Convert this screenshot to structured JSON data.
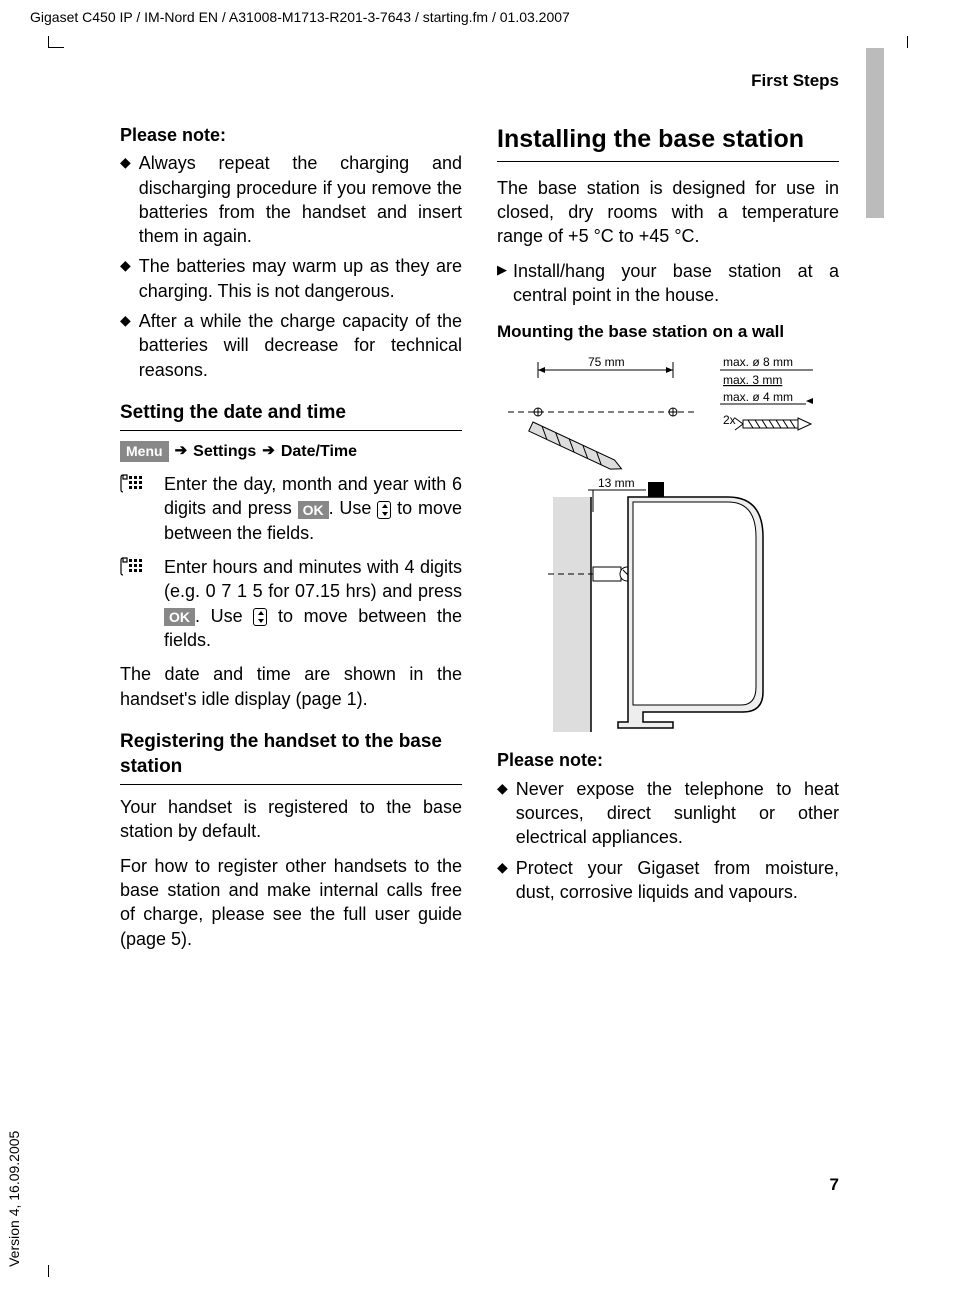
{
  "header": "Gigaset C450 IP / IM-Nord EN / A31008-M1713-R201-3-7643 / starting.fm / 01.03.2007",
  "section_header": "First Steps",
  "left": {
    "note_heading": "Please note:",
    "notes": [
      "Always repeat the charging and discharging procedure if you remove the batteries from the handset and insert them in again.",
      "The batteries may warm up as they are charging. This is not dangerous.",
      "After a while the charge capacity of the batteries will decrease for technical reasons."
    ],
    "h2_datetime": "Setting the date and time",
    "menu_path": {
      "menu": "Menu",
      "settings": "Settings",
      "datetime": "Date/Time"
    },
    "instr1": "Enter the day, month and year with 6 digits and press ",
    "instr1_ok": "OK",
    "instr1_rest": ". Use ",
    "instr1_rest2": " to move between the fields.",
    "instr2": "Enter hours and minutes with 4 digits (e.g. 0 7 1 5 for 07.15 hrs) and press ",
    "instr2_ok": "OK",
    "instr2_rest": ". Use ",
    "instr2_rest2": " to move between the fields.",
    "datetime_footer": "The date and time are shown in the handset's idle display (page 1).",
    "h2_register": "Registering the handset to the base station",
    "register_p1": "Your handset is registered to the base station by default.",
    "register_p2": "For how to register other handsets to the base station and make internal calls free of charge, please see the full user guide (page 5)."
  },
  "right": {
    "h1": "Installing the base station",
    "intro": "The base station is designed for use in closed, dry rooms with a temperature range of +5 °C to +45 °C.",
    "step1": "Install/hang your base station at a central point in the house.",
    "h3_mounting": "Mounting the base station on a wall",
    "diagram_labels": {
      "spacing": "75 mm",
      "max_hole": "max. ø 8 mm",
      "max_depth": "max.    3 mm",
      "max_screw": "max. ø 4 mm",
      "count": "2x",
      "drop": "13 mm"
    },
    "note_heading": "Please note:",
    "notes": [
      "Never expose the telephone to heat sources, direct sunlight or other electrical appliances.",
      "Protect your Gigaset from moisture, dust, corrosive liquids and vapours."
    ]
  },
  "page_number": "7",
  "version": "Version 4, 16.09.2005"
}
